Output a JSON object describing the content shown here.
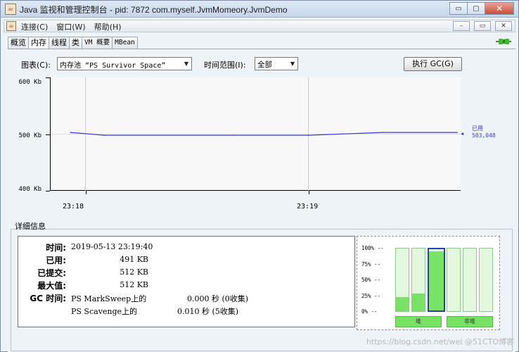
{
  "window": {
    "title": "Java 监视和管理控制台 - pid: 7872 com.myself.JvmMomeory.JvmDemo",
    "minimize": "▭",
    "maximize": "▢",
    "close": "✕"
  },
  "menu": {
    "items": [
      "连接(C)",
      "窗口(W)",
      "帮助(H)"
    ],
    "frame_buttons": [
      "–",
      "▭",
      "✕"
    ]
  },
  "tabs": [
    "概览",
    "内存",
    "线程",
    "类",
    "VM 概要",
    "MBean"
  ],
  "active_tab": "内存",
  "controls": {
    "chart_label": "图表(C):",
    "chart_value": "内存池 “PS Survivor Space”",
    "time_label": "时间范围(I):",
    "time_value": "全部",
    "gc_button": "执行 GC(G)"
  },
  "chart_data": {
    "type": "line",
    "title": "",
    "xlabel": "",
    "ylabel": "",
    "y_ticks": [
      "600 Kb",
      "500 Kb",
      "400 Kb"
    ],
    "x_ticks": [
      "23:18",
      "23:19"
    ],
    "ylim": [
      400,
      600
    ],
    "grid": true,
    "legend_position": "right",
    "series": [
      {
        "name": "已用",
        "latest_label": "503,048",
        "color": "#3a3ad0",
        "x": [
          "23:17:56",
          "23:18:05",
          "23:18:40",
          "23:19:00",
          "23:19:20",
          "23:19:40"
        ],
        "values": [
          503,
          498,
          498,
          498,
          503,
          503
        ]
      }
    ]
  },
  "details": {
    "title": "详细信息",
    "rows": [
      {
        "label": "时间:",
        "value": "2019-05-13 23:19:40"
      },
      {
        "label": "已用:",
        "value": "491 KB"
      },
      {
        "label": "已提交:",
        "value": "512 KB"
      },
      {
        "label": "最大值:",
        "value": "512 KB"
      }
    ],
    "gc_label": "GC 时间:",
    "gc_rows": [
      {
        "name": "PS MarkSweep上的",
        "value": "0.000 秒 (0收集)"
      },
      {
        "name": "PS Scavenge上的",
        "value": "0.010 秒 (5收集)"
      }
    ]
  },
  "pools": {
    "pct_labels": [
      "100% --",
      "75% --",
      "50% --",
      "25% --",
      "0% --"
    ],
    "bars_percent": [
      22,
      28,
      97,
      0,
      0,
      0
    ],
    "selected_index": 2,
    "groups": [
      "堆",
      "非堆"
    ]
  },
  "watermark": "https://blog.csdn.net/wei @51CTO博客"
}
